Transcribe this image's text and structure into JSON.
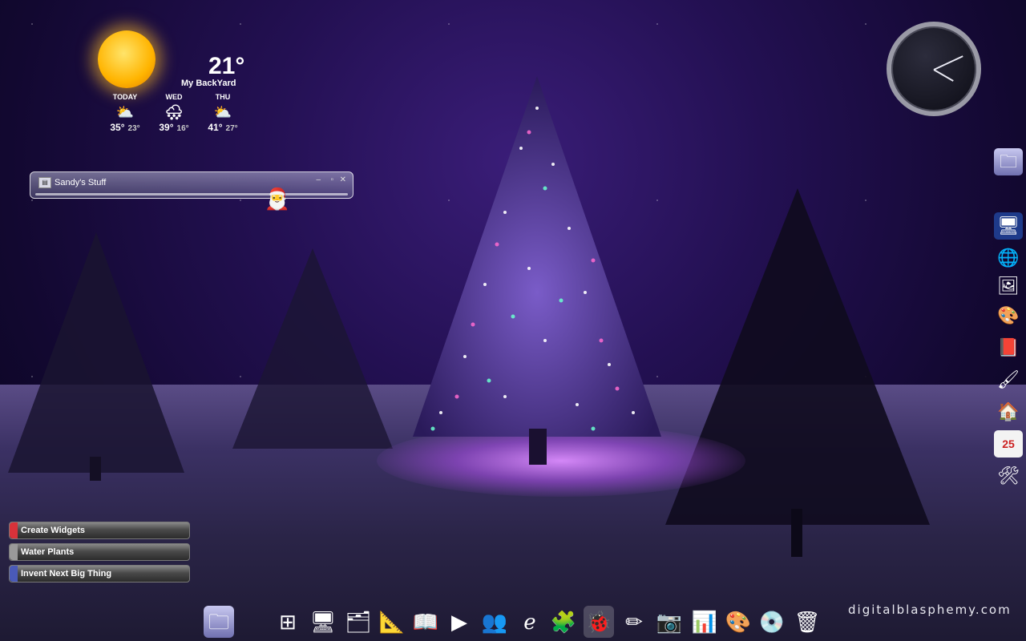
{
  "weather": {
    "current_temp": "21°",
    "location": "My BackYard",
    "forecast": [
      {
        "day": "TODAY",
        "hi": "35°",
        "lo": "23°",
        "icon": "partly-sunny-icon"
      },
      {
        "day": "WED",
        "hi": "39°",
        "lo": "16°",
        "icon": "snow-cloud-icon"
      },
      {
        "day": "THU",
        "hi": "41°",
        "lo": "27°",
        "icon": "partly-sunny-icon"
      }
    ]
  },
  "sandys_stuff": {
    "title": "Sandy's Stuff"
  },
  "clock": {
    "hour_angle": 30,
    "minute_angle": -25
  },
  "tasks": [
    {
      "label": "Create Widgets",
      "color": "#d8323a"
    },
    {
      "label": "Water Plants",
      "color": "#9a9a9a"
    },
    {
      "label": "Invent Next Big Thing",
      "color": "#4a5ab8"
    }
  ],
  "side_dock_icons": [
    "folder-icon",
    "s-monitor-icon",
    "network-globe-icon",
    "picture-monitor-icon",
    "paint-palette-icon",
    "red-book-icon",
    "paint-picture-icon",
    "photo-frame-icon",
    "calendar-25-icon",
    "blue-tools-icon"
  ],
  "calendar_day": "25",
  "dock_icons": [
    "folder-icon",
    "windows-logo-icon",
    "monitor-icon",
    "documents-icon",
    "compass-icon",
    "open-book-icon",
    "media-player-icon",
    "messenger-people-icon",
    "internet-explorer-icon",
    "puzzle-icon",
    "ladybug-icon",
    "pencil-cup-icon",
    "photo-camera-icon",
    "chart-icon",
    "color-palette-icon",
    "music-disc-icon",
    "trash-can-icon"
  ],
  "brand": "digitalblasphemy.com"
}
